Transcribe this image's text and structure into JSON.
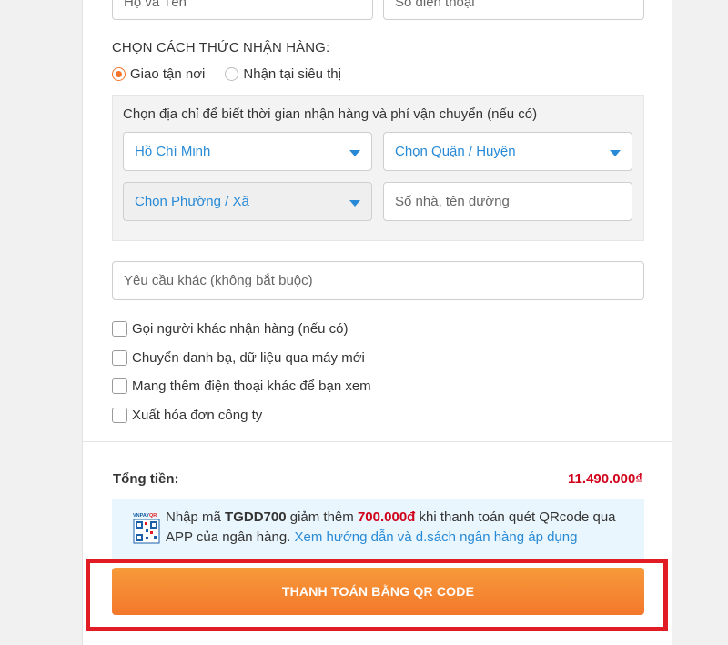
{
  "form": {
    "name_placeholder": "Họ và Tên",
    "phone_placeholder": "Số điện thoại"
  },
  "delivery": {
    "title": "CHỌN CÁCH THỨC NHẬN HÀNG:",
    "options": [
      "Giao tận nơi",
      "Nhận tại siêu thị"
    ],
    "selected": "Giao tận nơi",
    "address_hint": "Chọn địa chỉ để biết thời gian nhận hàng và phí vận chuyển (nếu có)",
    "city": "Hồ Chí Minh",
    "district": "Chọn Quận / Huyện",
    "ward": "Chọn Phường / Xã",
    "street_placeholder": "Số nhà, tên đường"
  },
  "note_placeholder": "Yêu cầu khác (không bắt buộc)",
  "extras": [
    "Gọi người khác nhận hàng (nếu có)",
    "Chuyển danh bạ, dữ liệu qua máy mới",
    "Mang thêm điện thoại khác để bạn xem",
    "Xuất hóa đơn công ty"
  ],
  "summary": {
    "total_label": "Tổng tiền:",
    "total_value": "11.490.000₫"
  },
  "promo": {
    "icon": "vnpay-qr-icon",
    "text_1": "Nhập mã ",
    "code": "TGDD700",
    "text_2": " giảm thêm ",
    "amount": "700.000đ",
    "text_3": " khi thanh toán quét QRcode qua APP của ngân hàng. ",
    "link": "Xem hướng dẫn và d.sách ngân hàng áp dụng"
  },
  "pay_button": "THANH TOÁN BẰNG QR CODE",
  "colors": {
    "accent": "#f7752a",
    "link": "#288ad6",
    "price": "#d0021b",
    "highlight": "#e11c24"
  }
}
